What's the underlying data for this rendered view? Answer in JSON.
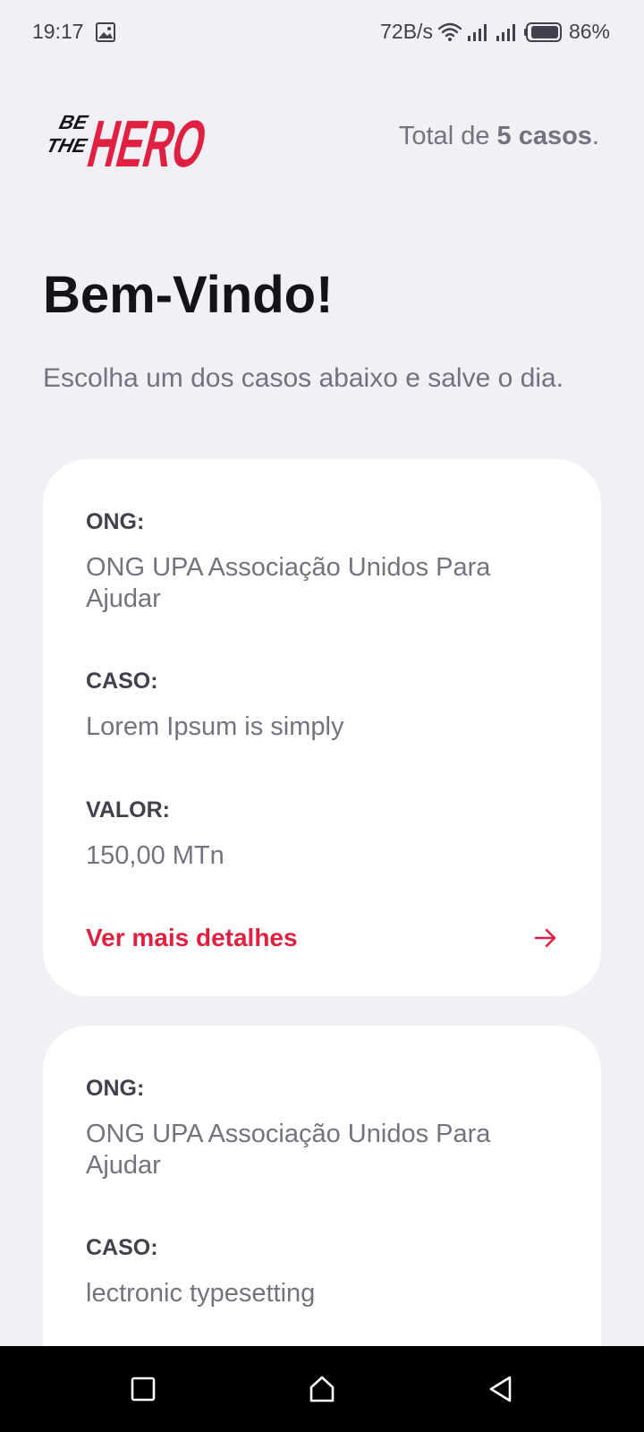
{
  "status_bar": {
    "time": "19:17",
    "network_speed": "72B/s",
    "battery": "86%"
  },
  "header": {
    "logo_line1": "BE",
    "logo_line2": "THE",
    "logo_word": "HERO",
    "total_prefix": "Total de ",
    "total_count": "5 casos",
    "total_suffix": "."
  },
  "welcome": {
    "title": "Bem-Vindo!",
    "subtitle": "Escolha um dos casos abaixo e salve o dia."
  },
  "incidents": [
    {
      "ong_label": "ONG:",
      "ong_value": "ONG UPA Associação Unidos Para Ajudar",
      "case_label": "CASO:",
      "case_value": "Lorem Ipsum is simply",
      "value_label": "VALOR:",
      "value_value": "150,00 MTn",
      "details_label": "Ver mais detalhes"
    },
    {
      "ong_label": "ONG:",
      "ong_value": "ONG UPA Associação Unidos Para Ajudar",
      "case_label": "CASO:",
      "case_value": "lectronic typesetting"
    }
  ],
  "colors": {
    "background": "#f0f0f5",
    "accent": "#e02041",
    "card": "#ffffff",
    "title": "#13131a",
    "muted": "#737380",
    "label": "#41414d"
  },
  "icons": {
    "gallery": "image-icon",
    "wifi": "wifi-icon",
    "signal": "signal-icon",
    "battery": "battery-icon",
    "arrow": "arrow-right-icon",
    "recent": "square-icon",
    "home": "home-icon",
    "back": "triangle-back-icon"
  }
}
